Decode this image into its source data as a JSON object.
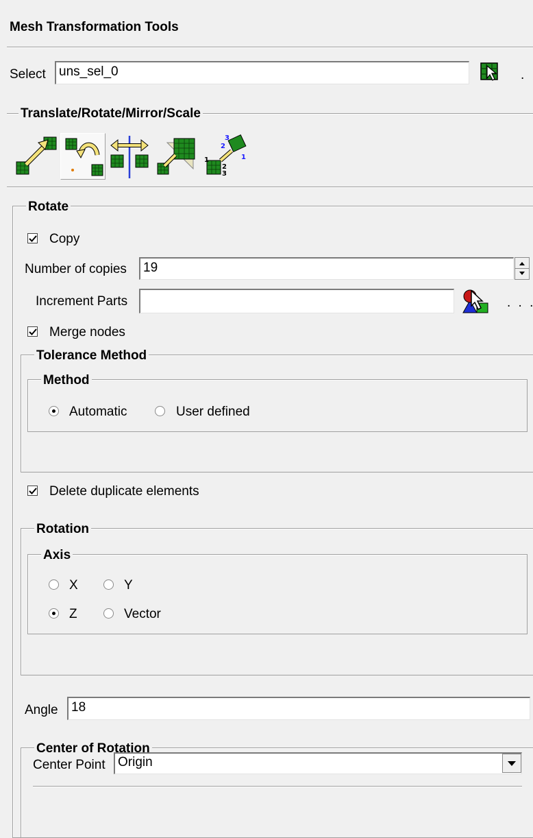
{
  "header": {
    "title": "Mesh Transformation Tools"
  },
  "select": {
    "label": "Select",
    "value": "uns_sel_0",
    "more": ". ."
  },
  "transform_group": {
    "legend": "Translate/Rotate/Mirror/Scale",
    "tools": [
      {
        "name": "translate",
        "icon": "translate-mesh-icon"
      },
      {
        "name": "rotate",
        "icon": "rotate-mesh-icon",
        "selected": true
      },
      {
        "name": "mirror",
        "icon": "mirror-mesh-icon"
      },
      {
        "name": "scale",
        "icon": "scale-mesh-icon"
      },
      {
        "name": "transform-3-points",
        "icon": "three-point-transform-icon"
      }
    ]
  },
  "rotate": {
    "legend": "Rotate",
    "copy": {
      "label": "Copy",
      "checked": true
    },
    "number_of_copies": {
      "label": "Number of copies",
      "value": "19"
    },
    "increment_parts": {
      "label": "Increment Parts",
      "value": "",
      "more": ". . ."
    },
    "merge_nodes": {
      "label": "Merge nodes",
      "checked": true
    },
    "tolerance": {
      "legend": "Tolerance Method",
      "method_legend": "Method",
      "options": [
        {
          "label": "Automatic",
          "selected": true
        },
        {
          "label": "User defined",
          "selected": false
        }
      ]
    },
    "delete_duplicates": {
      "label": "Delete duplicate elements",
      "checked": true
    },
    "rotation": {
      "legend": "Rotation",
      "axis_legend": "Axis",
      "options": [
        {
          "label": "X",
          "selected": false
        },
        {
          "label": "Y",
          "selected": false
        },
        {
          "label": "Z",
          "selected": true
        },
        {
          "label": "Vector",
          "selected": false
        }
      ]
    },
    "angle": {
      "label": "Angle",
      "value": "18"
    },
    "center": {
      "legend": "Center of Rotation",
      "label": "Center Point",
      "value": "Origin"
    }
  }
}
